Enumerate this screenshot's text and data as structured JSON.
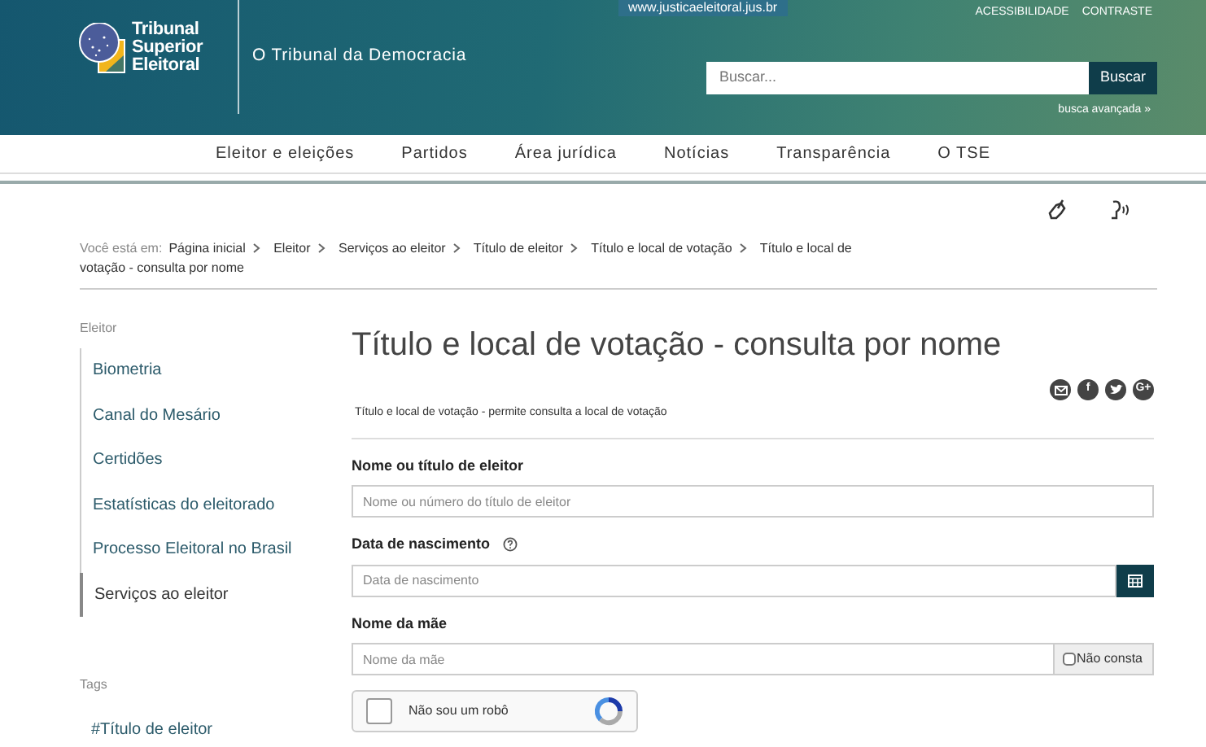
{
  "header": {
    "site_link": "www.justicaeleitoral.jus.br",
    "top_links": [
      "ACESSIBILIDADE",
      "CONTRASTE"
    ],
    "logo_lines": [
      "Tribunal",
      "Superior",
      "Eleitoral"
    ],
    "tagline": "O Tribunal da Democracia",
    "search": {
      "placeholder": "Buscar...",
      "button": "Buscar"
    },
    "advanced_search": "busca avançada »"
  },
  "nav": [
    "Eleitor e eleições",
    "Partidos",
    "Área jurídica",
    "Notícias",
    "Transparência",
    "O TSE"
  ],
  "breadcrumb": {
    "prefix": "Você está em:",
    "items": [
      "Página inicial",
      "Eleitor",
      "Serviços ao eleitor",
      "Título de eleitor",
      "Título e local de votação"
    ],
    "current_lines": [
      "Título e local de",
      "votação - consulta por nome"
    ]
  },
  "sidebar": {
    "title": "Eleitor",
    "items": [
      {
        "label": "Biometria",
        "selected": false
      },
      {
        "label": "Canal do Mesário",
        "selected": false
      },
      {
        "label": "Certidões",
        "selected": false
      },
      {
        "label": "Estatísticas do eleitorado",
        "selected": false
      },
      {
        "label": "Processo Eleitoral no Brasil",
        "selected": false
      },
      {
        "label": "Serviços ao eleitor",
        "selected": true
      }
    ]
  },
  "tags": {
    "title": "Tags",
    "items": [
      "#Título de eleitor"
    ]
  },
  "page_title": "Título e local de votação - consulta por nome",
  "share": [
    {
      "kind": "email"
    },
    {
      "kind": "letter",
      "label": "f"
    },
    {
      "kind": "twitter"
    },
    {
      "kind": "letter",
      "label": "G+"
    }
  ],
  "description": "Título e local de votação - permite consulta a local de votação",
  "form": [
    {
      "kind": "text",
      "label": "Nome ou título de eleitor",
      "placeholder": "Nome ou número do título de eleitor"
    },
    {
      "kind": "date",
      "label": "Data de nascimento",
      "placeholder": "Data de nascimento",
      "help": true
    },
    {
      "kind": "checkbox-addon",
      "label": "Nome da mãe",
      "placeholder": "Nome da mãe",
      "addon": "Não consta",
      "checked": false
    }
  ],
  "captcha": {
    "label": "Não sou um robô",
    "checked": false
  }
}
